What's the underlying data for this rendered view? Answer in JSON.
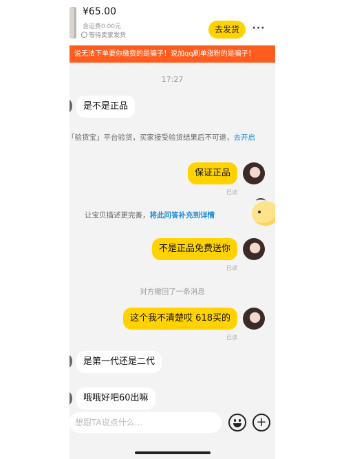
{
  "header": {
    "price": "¥65.00",
    "shipping_fee": "含运费0.00元",
    "status": "等待卖家发货",
    "ship_button": "去发货",
    "more_button": "···"
  },
  "warning_banner": "：说无法下单要你缴费的是骗子！说加qq刷单涨粉的是骗子！",
  "chat": {
    "timestamp": "17:27",
    "messages": [
      {
        "side": "left",
        "text": "是不是正品"
      },
      {
        "side": "system",
        "text": "「验货宝」平台验货，买家接受验货结果后不可退，",
        "link": "去开启"
      },
      {
        "side": "right",
        "text": "保证正品",
        "status": "已读"
      },
      {
        "side": "system",
        "text": "让宝贝描述更完善，",
        "link": "将此问答补充到详情"
      },
      {
        "side": "right",
        "text": "不是正品免费送你",
        "status": "已读"
      },
      {
        "side": "recall",
        "text": "对方撤回了一条消息"
      },
      {
        "side": "right",
        "text": "这个我不清楚哎 618买的",
        "status": "已读"
      },
      {
        "side": "left",
        "text": "是第一代还是二代"
      },
      {
        "side": "left",
        "text": "哦哦好吧60出嘛"
      }
    ]
  },
  "input": {
    "placeholder": "想跟TA说点什么..."
  },
  "icons": {
    "emoji": "emoji-icon",
    "plus": "plus-icon",
    "clock": "clock-icon"
  },
  "colors": {
    "accent_yellow": "#ffd200",
    "banner_orange": "#ff5d1f",
    "link_blue": "#1d8cd9"
  }
}
